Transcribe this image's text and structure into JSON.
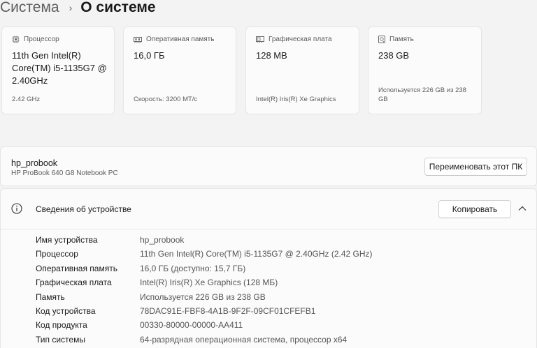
{
  "breadcrumb": {
    "parent": "Система",
    "separator": "›",
    "current": "О системе"
  },
  "cards": [
    {
      "icon": "processor-icon",
      "label": "Процессор",
      "value": "11th Gen Intel(R) Core(TM) i5-1135G7 @ 2.40GHz",
      "sub": "2.42 GHz"
    },
    {
      "icon": "memory-icon",
      "label": "Оперативная память",
      "value": "16,0 ГБ",
      "sub": "Скорость: 3200 MT/c"
    },
    {
      "icon": "graphics-card-icon",
      "label": "Графическая плата",
      "value": "128 MB",
      "sub": "Intel(R) Iris(R) Xe Graphics"
    },
    {
      "icon": "storage-icon",
      "label": "Память",
      "value": "238 GB",
      "sub": "Используется 226 GB из 238 GB"
    }
  ],
  "pc": {
    "name": "hp_probook",
    "model": "HP ProBook 640 G8 Notebook PC",
    "rename_label": "Переименовать этот ПК"
  },
  "details": {
    "title": "Сведения об устройстве",
    "copy_label": "Копировать",
    "rows": [
      {
        "label": "Имя устройства",
        "value": "hp_probook"
      },
      {
        "label": "Процессор",
        "value": "11th Gen Intel(R) Core(TM) i5-1135G7 @ 2.40GHz (2.42 GHz)"
      },
      {
        "label": "Оперативная память",
        "value": "16,0 ГБ (доступно: 15,7 ГБ)"
      },
      {
        "label": "Графическая плата",
        "value": "Intel(R) Iris(R) Xe Graphics (128 МБ)"
      },
      {
        "label": "Память",
        "value": "Используется 226 GB из 238 GB"
      },
      {
        "label": "Код устройства",
        "value": "78DAC91E-FBF8-4A1B-9F2F-09CF01CFEFB1"
      },
      {
        "label": "Код продукта",
        "value": "00330-80000-00000-AA411"
      },
      {
        "label": "Тип системы",
        "value": "64-разрядная операционная система, процессор x64"
      }
    ]
  }
}
